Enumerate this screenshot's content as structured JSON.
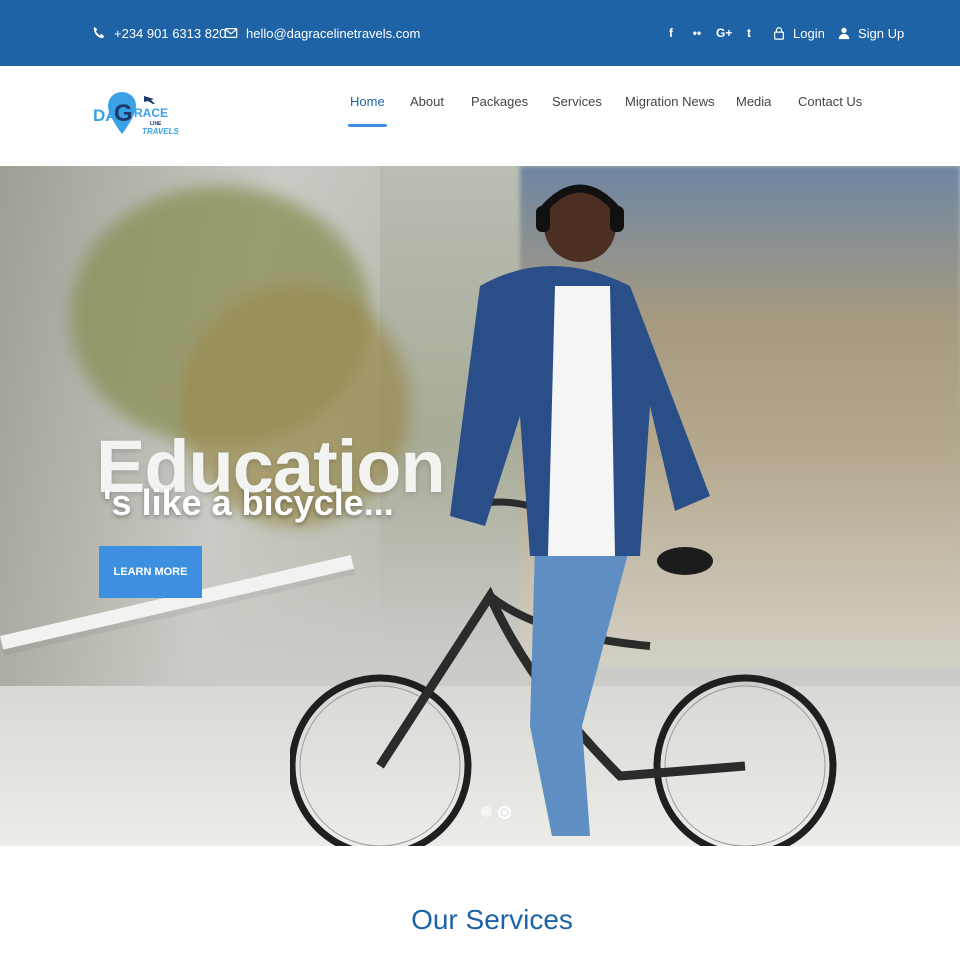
{
  "topbar": {
    "phone": "+234 901 6313 820",
    "email": "hello@dagracelinetravels.com",
    "social": [
      {
        "icon": "facebook-icon",
        "glyph": "f"
      },
      {
        "icon": "flickr-icon",
        "glyph": "••"
      },
      {
        "icon": "google-plus-icon",
        "glyph": "G+"
      },
      {
        "icon": "twitter-icon",
        "glyph": "t"
      }
    ],
    "login_label": "Login",
    "signup_label": "Sign Up"
  },
  "logo": {
    "text_da": "DA",
    "text_g": "G",
    "text_race": "RACE",
    "text_line": "LINE",
    "text_travels": "TRAVELS"
  },
  "nav": {
    "items": [
      {
        "label": "Home",
        "active": true
      },
      {
        "label": "About"
      },
      {
        "label": "Packages"
      },
      {
        "label": "Services"
      },
      {
        "label": "Migration News"
      },
      {
        "label": "Media"
      },
      {
        "label": "Contact Us"
      }
    ]
  },
  "hero": {
    "title": "Education",
    "subtitle": "'s like a bicycle...",
    "button_label": "LEARN MORE",
    "slides": 2,
    "active_slide": 2
  },
  "services": {
    "title": "Our Services"
  },
  "colors": {
    "topbar": "#1d63a6",
    "accent": "#3d8fe0",
    "heading": "#1d63a6"
  }
}
